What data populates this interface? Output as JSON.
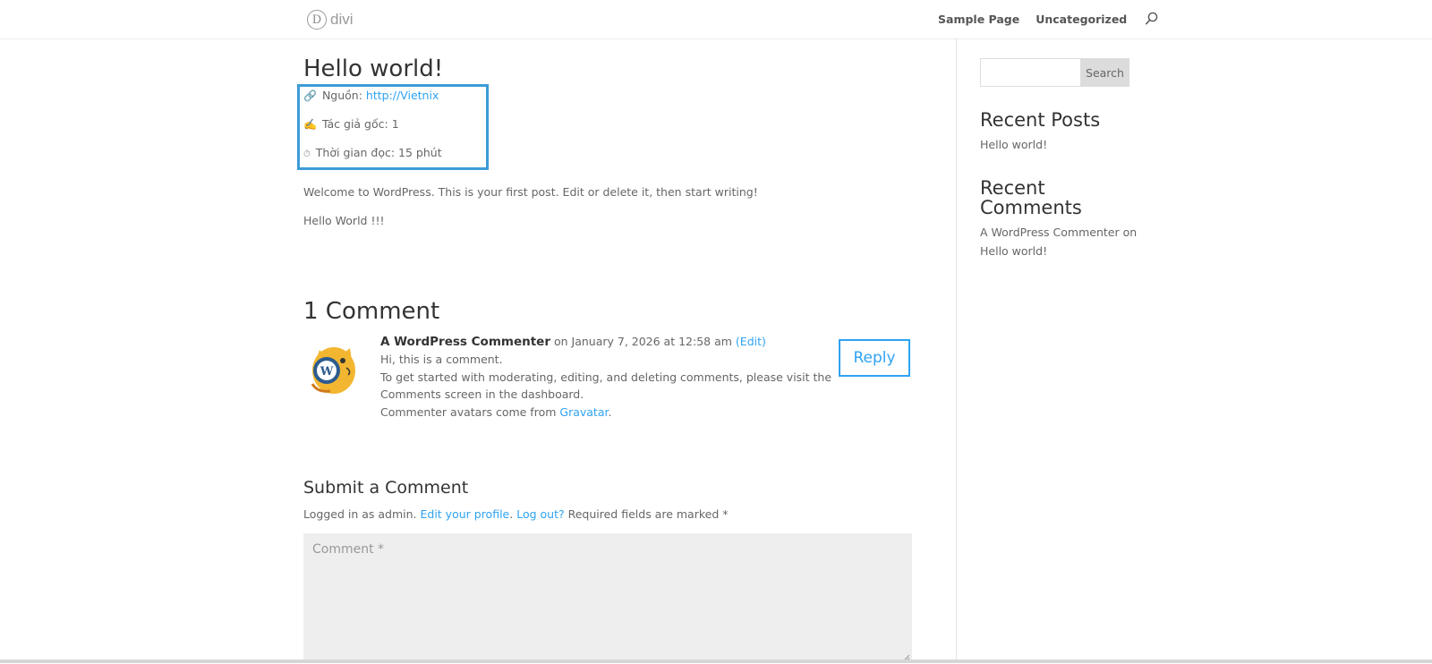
{
  "header": {
    "logo_letter": "D",
    "logo_text": "divi",
    "nav": [
      "Sample Page",
      "Uncategorized"
    ]
  },
  "post": {
    "title": "Hello world!",
    "meta": {
      "source_label": "Nguồn:",
      "source_link": "http://Vietnix",
      "author": "Tác giả gốc: 1",
      "reading_time": "Thời gian đọc: 15 phút"
    },
    "paragraphs": [
      "Welcome to WordPress. This is your first post. Edit or delete it, then start writing!",
      "Hello World !!!"
    ]
  },
  "comments": {
    "title": "1 Comment",
    "items": [
      {
        "author": "A WordPress Commenter",
        "date": "on January 7, 2026 at 12:58 am",
        "edit": "(Edit)",
        "lines": [
          "Hi, this is a comment.",
          "To get started with moderating, editing, and deleting comments, please visit the",
          "Comments screen in the dashboard."
        ],
        "avatar_line_prefix": "Commenter avatars come from",
        "avatar_link": "Gravatar",
        "avatar_line_suffix": ".",
        "reply": "Reply"
      }
    ]
  },
  "form": {
    "title": "Submit a Comment",
    "logged_prefix": "Logged in as admin.",
    "edit_profile": "Edit your profile",
    "dot": ".",
    "logout": "Log out?",
    "required": "Required fields are marked *",
    "comment_placeholder": "Comment *"
  },
  "sidebar": {
    "search_button": "Search",
    "recent_posts_title": "Recent Posts",
    "recent_posts": [
      "Hello world!"
    ],
    "recent_comments_title_1": "Recent",
    "recent_comments_title_2": "Comments",
    "recent_comment_author": "A WordPress Commenter",
    "recent_comment_on": "on",
    "recent_comment_post": "Hello world!"
  },
  "colors": {
    "accent": "#2ea3f2",
    "highlight_box": "#3d9bd7"
  }
}
